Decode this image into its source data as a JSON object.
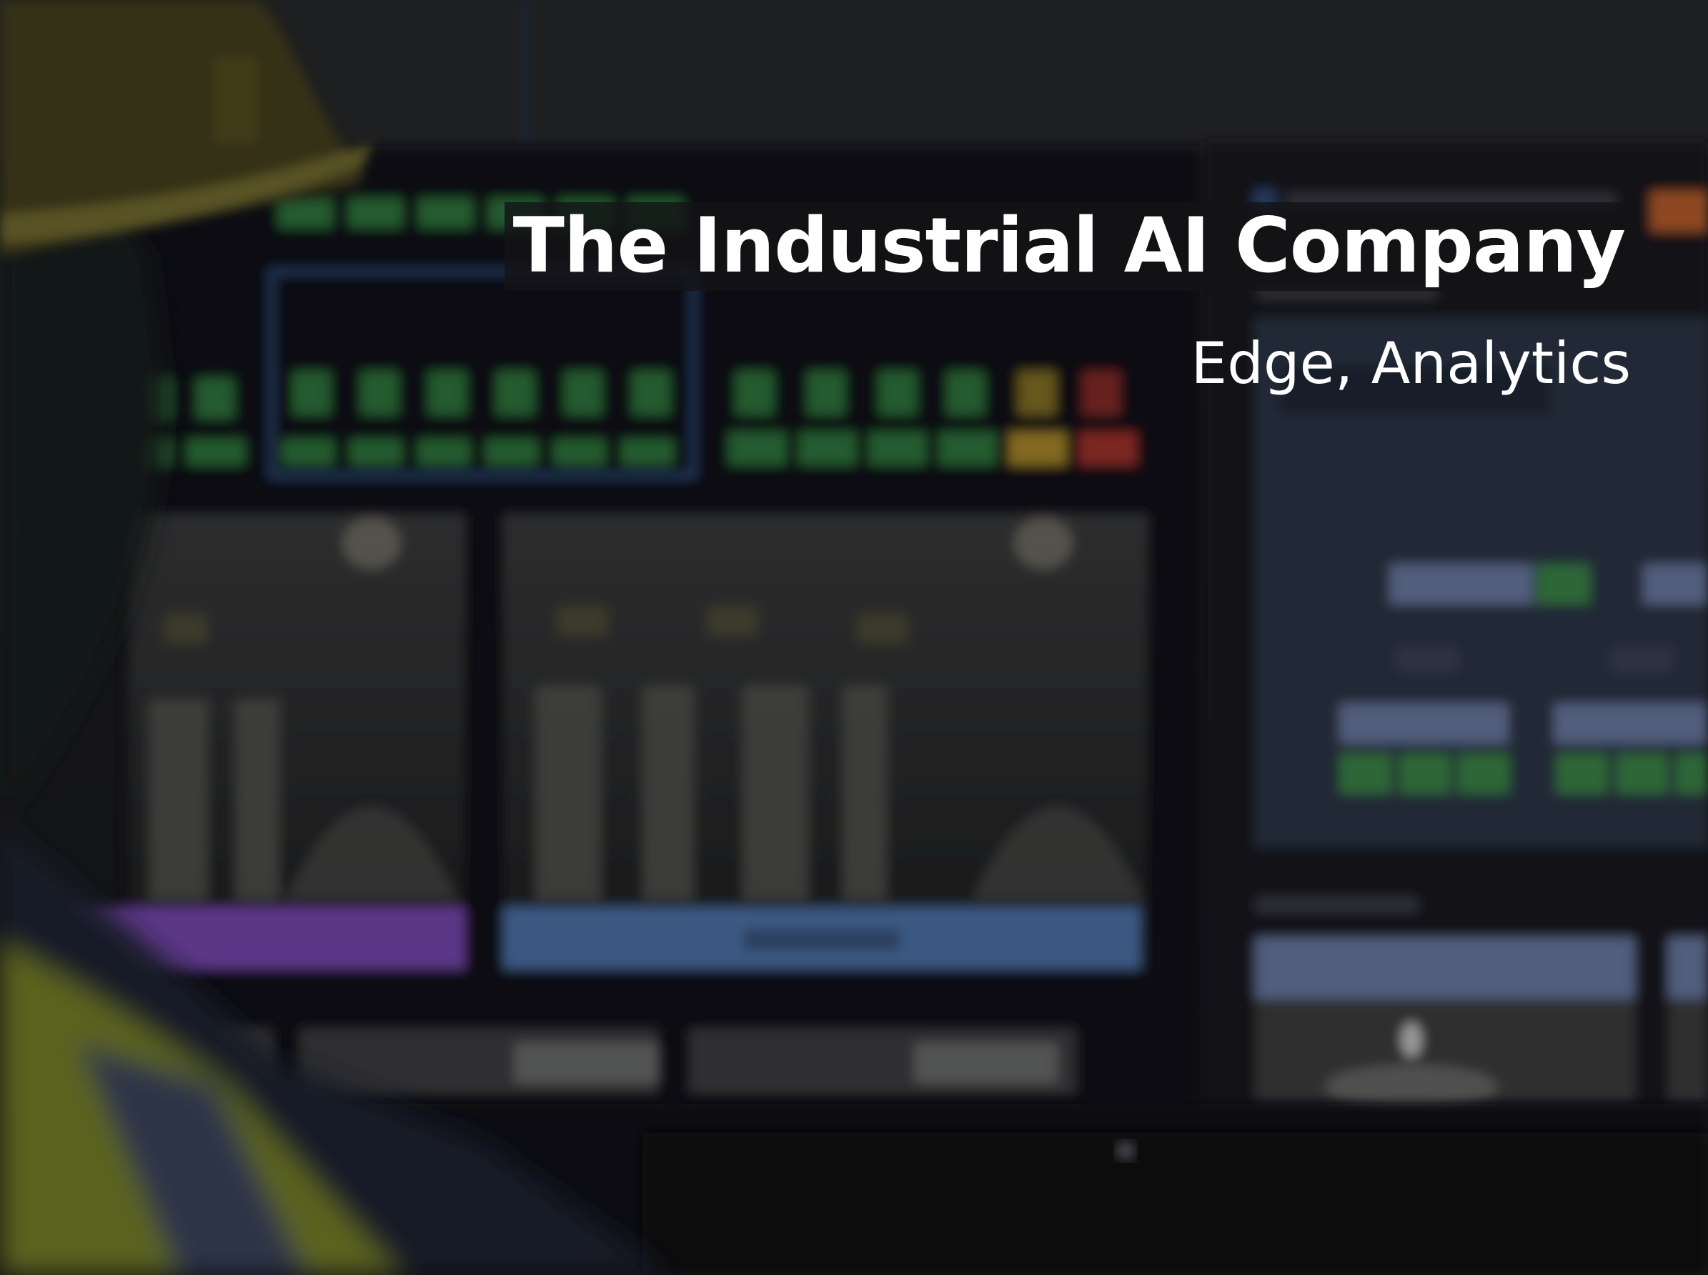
{
  "hero": {
    "title": "The Industrial AI Company",
    "subtitle": "Edge, Analytics"
  },
  "colors": {
    "text": "#ffffff",
    "title_background": "#141416",
    "monitor_green": "#3b8a4a",
    "monitor_yellow": "#c9a23a",
    "monitor_red": "#b03a33",
    "panel_purple": "#7b49b8",
    "panel_blue": "#4f77b0",
    "panel_slate": "#6d7ea8",
    "vest_yellow": "#b9c83a"
  },
  "background": {
    "description_icon": "photo-background"
  }
}
